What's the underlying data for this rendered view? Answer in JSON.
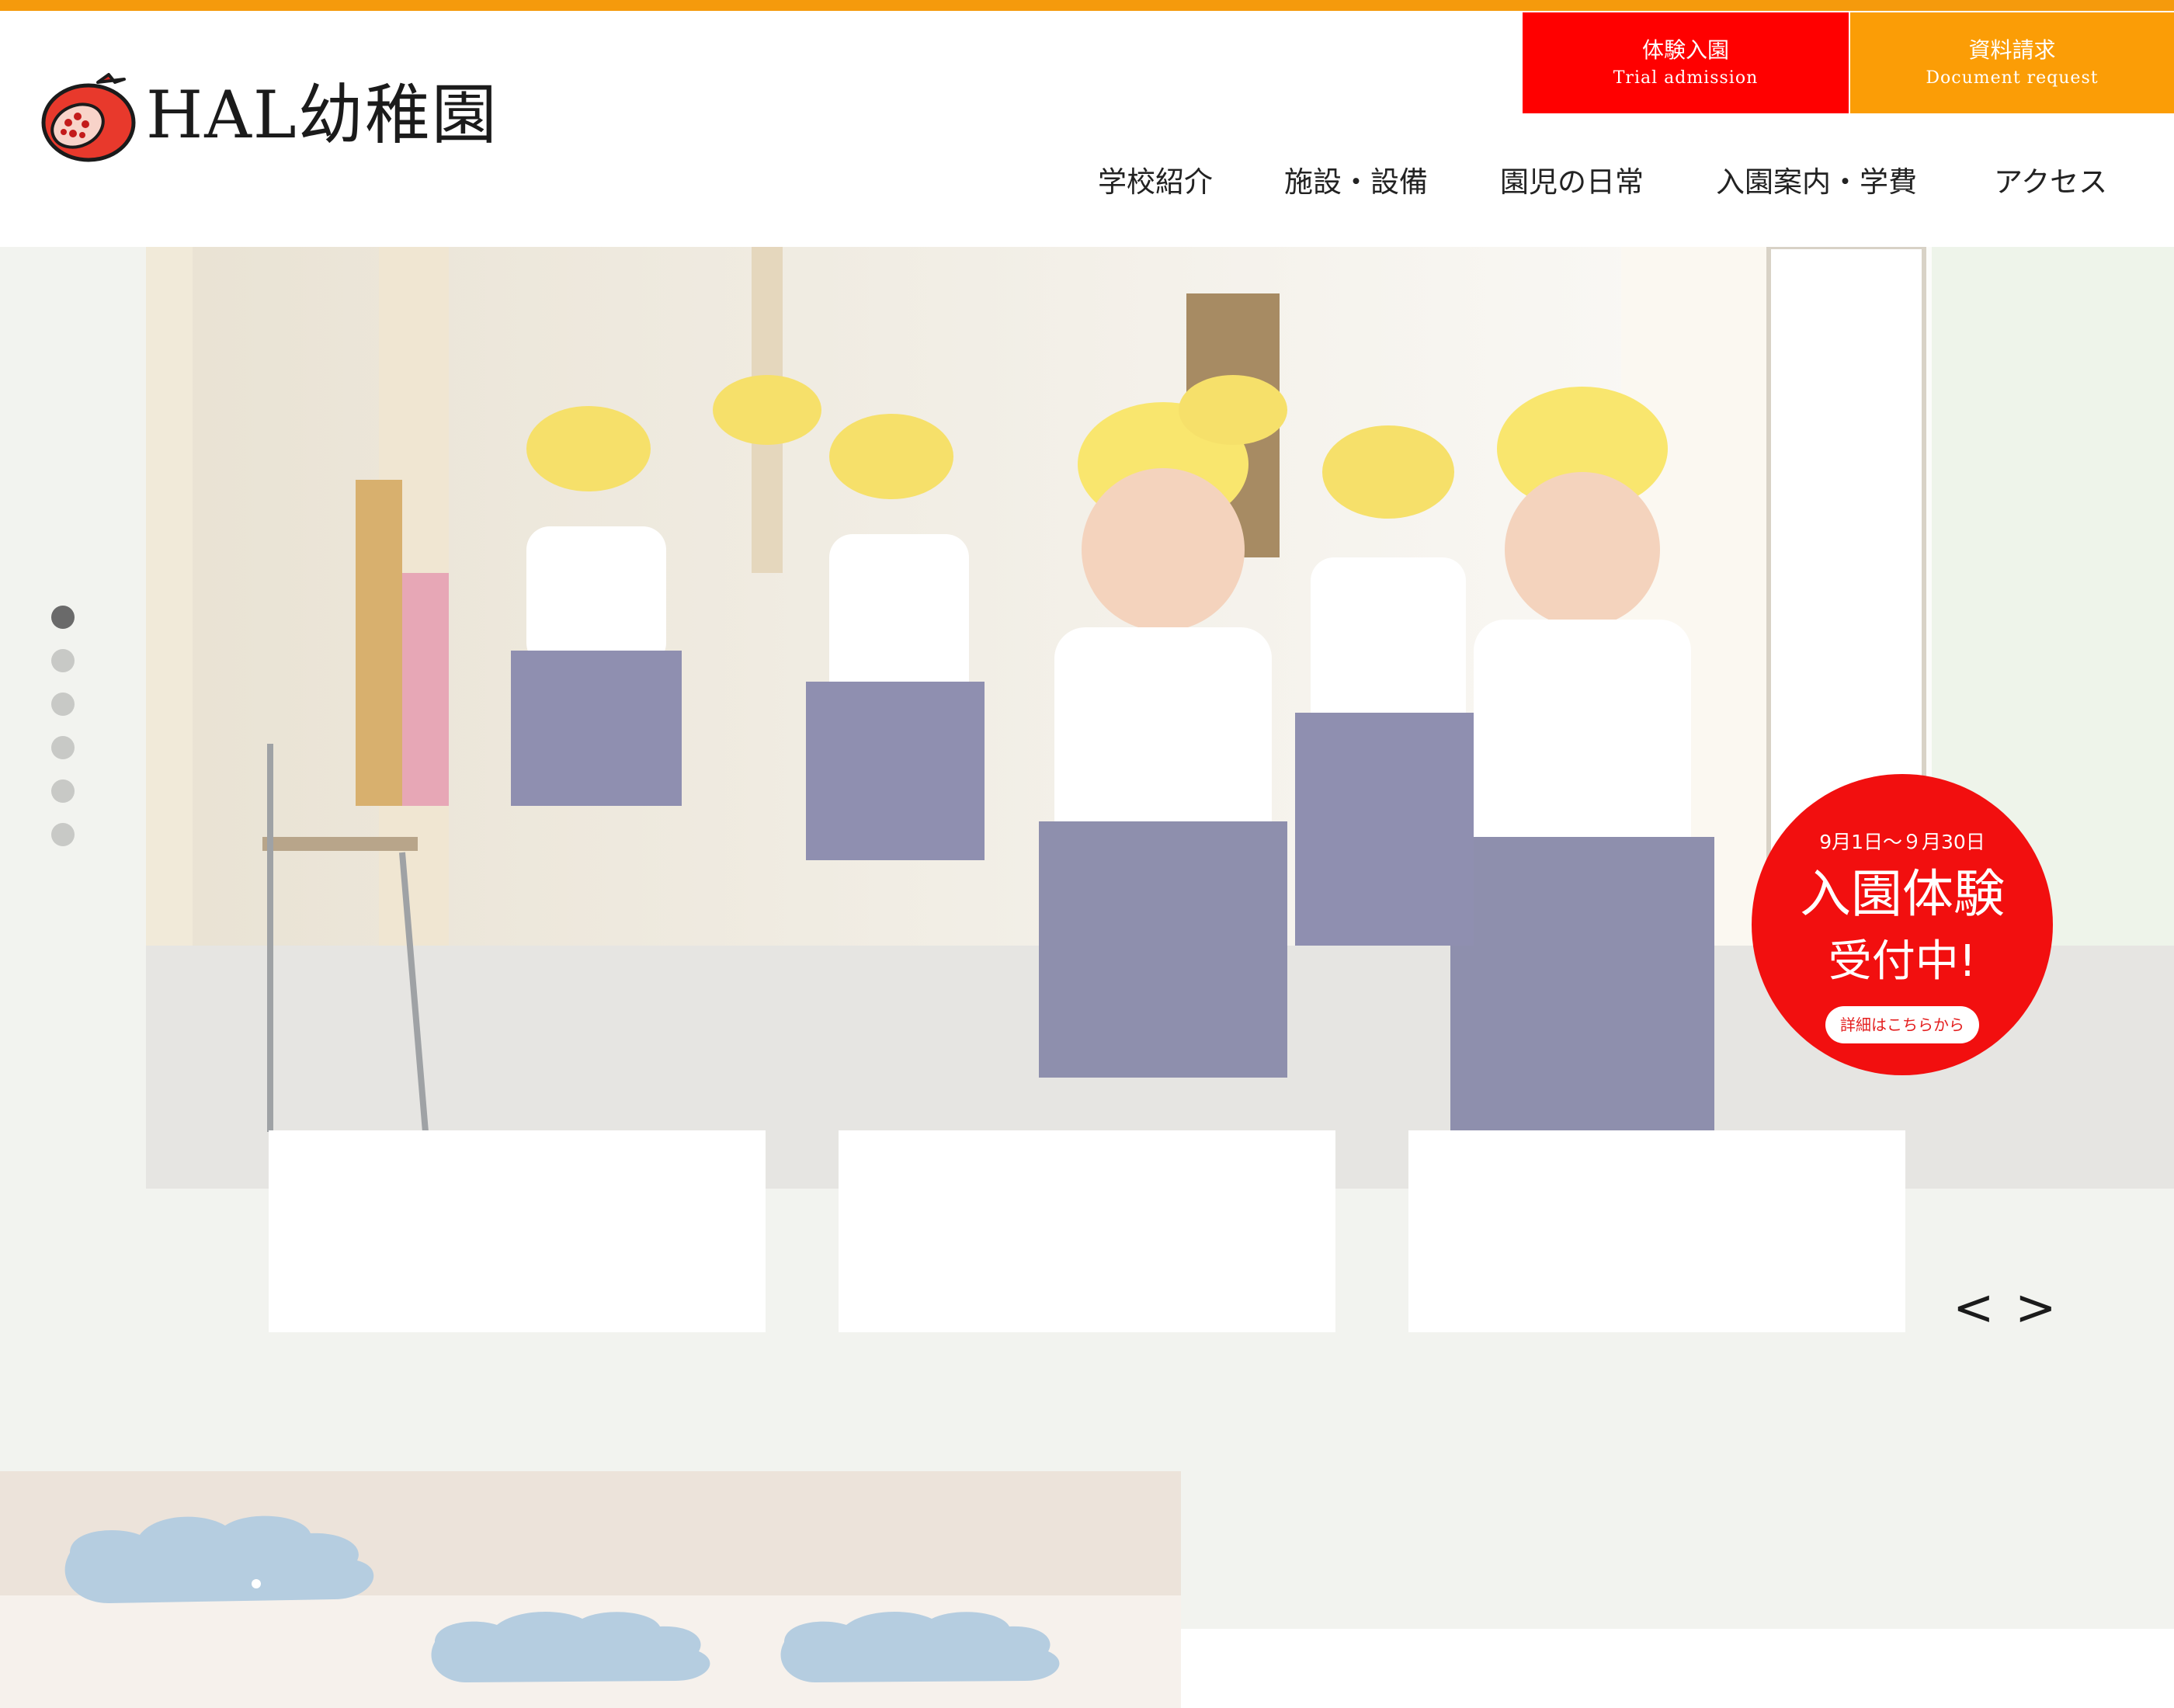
{
  "brand": {
    "name": "HAL幼稚園",
    "logo_icon": "pomegranate-icon",
    "accent_color": "#f59a0c"
  },
  "header_actions": {
    "trial": {
      "jp": "体験入園",
      "en": "Trial admission",
      "color": "#ff0000"
    },
    "document": {
      "jp": "資料請求",
      "en": "Document request",
      "color": "#fb9d06"
    }
  },
  "nav": {
    "items": [
      {
        "label": "学校紹介"
      },
      {
        "label": "施設・設備"
      },
      {
        "label": "園児の日常"
      },
      {
        "label": "入園案内・学費"
      },
      {
        "label": "アクセス"
      }
    ]
  },
  "hero": {
    "image_alt": "kindergarten-children-walking-hallway",
    "slide_count": 6,
    "active_slide": 1
  },
  "badge": {
    "date": "9月1日〜９月30日",
    "title": "入園体験",
    "subtitle": "受付中!",
    "button": "詳細はこちらから",
    "color": "#f20f0f"
  },
  "carousel": {
    "prev": "<",
    "next": ">"
  }
}
